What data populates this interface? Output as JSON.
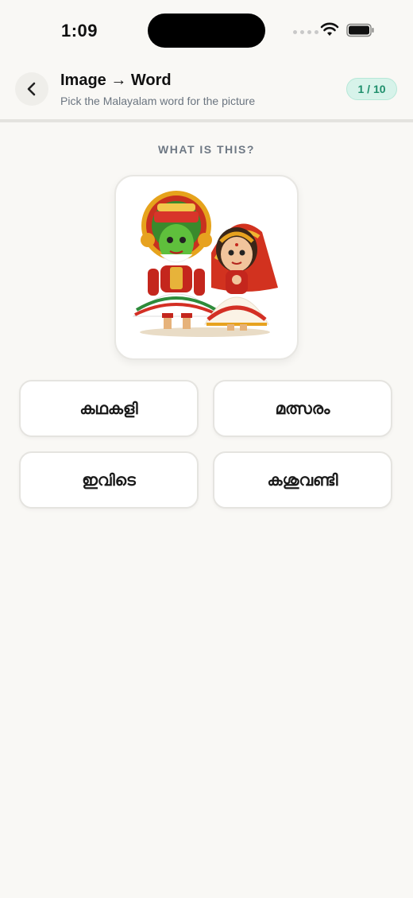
{
  "status_bar": {
    "time": "1:09",
    "icons": [
      "signal-dots-icon",
      "wifi-icon",
      "battery-icon"
    ]
  },
  "header": {
    "back_icon": "chevron-left-icon",
    "title": "Image → Word",
    "subtitle": "Pick the Malayalam word for the picture",
    "progress": "1 / 10"
  },
  "question": {
    "prompt": "WHAT IS THIS?",
    "image": "kathakali-and-mohiniyattam-dancers-illustration"
  },
  "options": [
    {
      "label": "കഥകളി"
    },
    {
      "label": "മത്സരം"
    },
    {
      "label": "ഇവിടെ"
    },
    {
      "label": "കശുവണ്ടി"
    }
  ],
  "colors": {
    "background": "#f9f8f5",
    "badge_bg": "#d7f3ea",
    "badge_text": "#1f8f6c",
    "muted_text": "#6e7884"
  }
}
